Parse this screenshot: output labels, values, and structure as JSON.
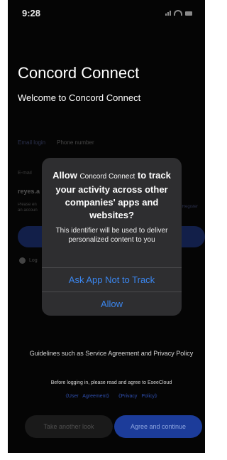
{
  "status_bar": {
    "time": "9:28"
  },
  "app": {
    "title": "Concord Connect",
    "subtitle": "Welcome to Concord Connect"
  },
  "login": {
    "tab_email": "Email login",
    "tab_phone": "Phone number",
    "email_label": "E-mail",
    "email_value": "reyes.a",
    "hint_line1": "Please en",
    "hint_line2": "an accoun",
    "side_link": "Register",
    "remember_label": "Log"
  },
  "dialog": {
    "title_prefix": "Allow",
    "title_app": "Concord Connect",
    "title_suffix": "to track your activity across other companies' apps and websites?",
    "message": "This identifier will be used to deliver personalized content to you",
    "button_ask": "Ask App Not to Track",
    "button_allow": "Allow"
  },
  "footer": {
    "guidelines": "Guidelines such as Service Agreement and Privacy Policy",
    "agree_text": "Before logging in, please read and agree to EseeCloud",
    "link_user_agreement": "《User Agreement》",
    "link_privacy": "《Privacy Policy》",
    "btn_take_another_look": "Take another look",
    "btn_agree_continue": "Agree and continue"
  },
  "colors": {
    "accent": "#3b86ee",
    "primary_button": "#1c3c9a",
    "dialog_bg": "#2e2e30"
  }
}
